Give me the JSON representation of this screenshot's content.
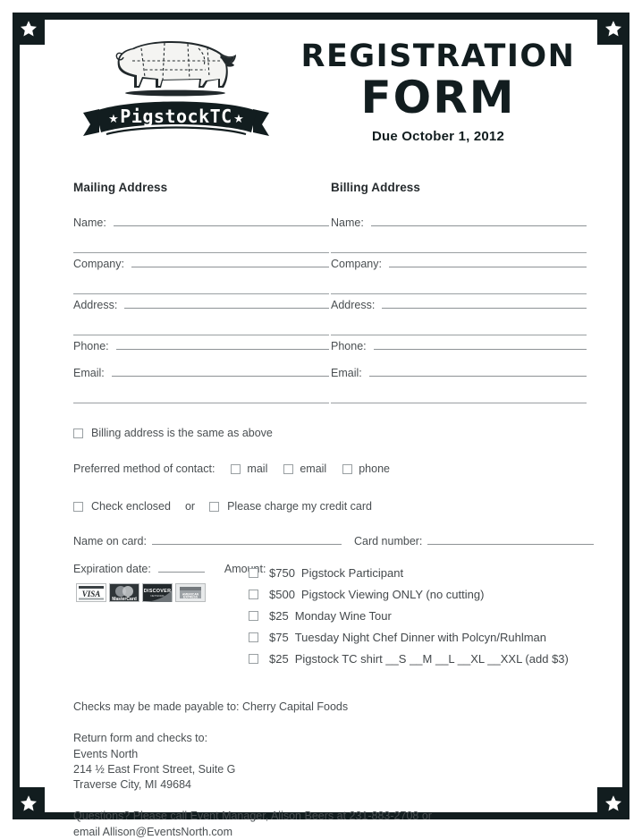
{
  "header": {
    "logo_banner_text": "PigstockTC",
    "logo_star": "★",
    "title_line1": "REGISTRATION",
    "title_line2": "FORM",
    "due_text": "Due October 1, 2012"
  },
  "mailing": {
    "heading": "Mailing Address",
    "fields": [
      {
        "label": "Name:",
        "value": ""
      },
      {
        "label": "Company:",
        "value": ""
      },
      {
        "label": "Address:",
        "value": ""
      },
      {
        "label": "Phone:",
        "value": ""
      },
      {
        "label": "Email:",
        "value": ""
      }
    ]
  },
  "billing": {
    "heading": "Billing Address",
    "fields": [
      {
        "label": "Name:",
        "value": ""
      },
      {
        "label": "Company:",
        "value": ""
      },
      {
        "label": "Address:",
        "value": ""
      },
      {
        "label": "Phone:",
        "value": ""
      },
      {
        "label": "Email:",
        "value": ""
      }
    ]
  },
  "same_as_above": {
    "label": "Billing address is the same as above",
    "checked": false
  },
  "preferred_contact": {
    "label": "Preferred method of contact:",
    "options": [
      {
        "label": "mail",
        "checked": false
      },
      {
        "label": "email",
        "checked": false
      },
      {
        "label": "phone",
        "checked": false
      }
    ]
  },
  "payment_method": {
    "check_label": "Check enclosed",
    "or_label": "or",
    "card_label": "Please charge my credit card",
    "check_checked": false,
    "card_checked": false
  },
  "card_details": {
    "name_label": "Name on card:",
    "name_value": "",
    "number_label": "Card number:",
    "number_value": "",
    "expiration_label": "Expiration date:",
    "expiration_value": "",
    "amount_label": "Amount:"
  },
  "card_logos": [
    {
      "name": "visa-logo",
      "text": "VISA"
    },
    {
      "name": "mastercard-logo",
      "text": "MasterCard"
    },
    {
      "name": "discover-logo",
      "text": "DISCOVER"
    },
    {
      "name": "amex-logo",
      "text": "AMERICAN EXPRESS"
    }
  ],
  "amount_options": [
    {
      "price": "$750",
      "desc": "Pigstock Participant",
      "checked": false
    },
    {
      "price": "$500",
      "desc": "Pigstock Viewing ONLY (no cutting)",
      "checked": false
    },
    {
      "price": "$25",
      "desc": "Monday Wine Tour",
      "checked": false
    },
    {
      "price": "$75",
      "desc": "Tuesday Night Chef Dinner with Polcyn/Ruhlman",
      "checked": false
    },
    {
      "price": "$25",
      "desc": "Pigstock TC shirt __S __M __L __XL __XXL (add $3)",
      "checked": false
    }
  ],
  "footer": {
    "payable": "Checks may be made payable to: Cherry Capital Foods",
    "return_heading": "Return form and checks to:",
    "return_org": "Events North",
    "return_street": "214 ½ East Front Street, Suite G",
    "return_city": "Traverse City, MI 49684",
    "questions_line1": "Questions? Please call Event Manager, Alison Beers at 231-883-2708 or",
    "questions_line2": "email Allison@EventsNorth.com"
  },
  "colors": {
    "frame": "#121d1f",
    "text": "#4a4f52",
    "heading": "#121d1f",
    "rule": "#8d9295"
  }
}
